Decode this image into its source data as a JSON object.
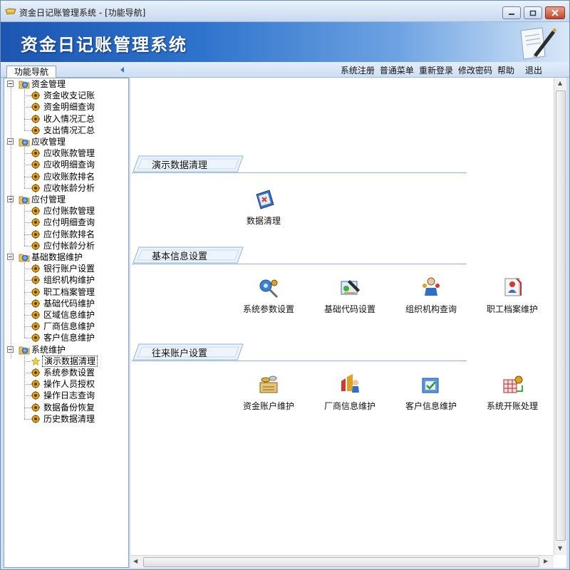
{
  "window": {
    "title": "资金日记账管理系统 - [功能导航]",
    "banner_title": "资金日记账管理系统"
  },
  "toolbar": {
    "nav_tab": "功能导航",
    "menu": [
      "系统注册",
      "普通菜单",
      "重新登录",
      "修改密码",
      "帮助",
      "退出"
    ]
  },
  "tree": {
    "groups": [
      {
        "label": "资金管理",
        "items": [
          "资金收支记账",
          "资金明细查询",
          "收入情况汇总",
          "支出情况汇总"
        ]
      },
      {
        "label": "应收管理",
        "items": [
          "应收账款管理",
          "应收明细查询",
          "应收账款排名",
          "应收帐龄分析"
        ]
      },
      {
        "label": "应付管理",
        "items": [
          "应付账款管理",
          "应付明细查询",
          "应付账款排名",
          "应付帐龄分析"
        ]
      },
      {
        "label": "基础数据维护",
        "items": [
          "银行账户设置",
          "组织机构维护",
          "职工档案管理",
          "基础代码维护",
          "区域信息维护",
          "厂商信息维护",
          "客户信息维护"
        ]
      },
      {
        "label": "系统维护",
        "items": [
          "演示数据清理",
          "系统参数设置",
          "操作人员授权",
          "操作日志查询",
          "数据备份恢复",
          "历史数据清理"
        ]
      }
    ],
    "selected": "演示数据清理"
  },
  "sections": [
    {
      "title": "演示数据清理",
      "tiles": [
        {
          "label": "数据清理",
          "icon": "data-clean-icon"
        }
      ]
    },
    {
      "title": "基本信息设置",
      "tiles": [
        {
          "label": "系统参数设置",
          "icon": "system-params-icon"
        },
        {
          "label": "基础代码设置",
          "icon": "base-code-icon"
        },
        {
          "label": "组织机构查询",
          "icon": "org-query-icon"
        },
        {
          "label": "职工档案维护",
          "icon": "staff-file-icon"
        }
      ]
    },
    {
      "title": "往来账户设置",
      "tiles": [
        {
          "label": "资金账户维护",
          "icon": "fund-account-icon"
        },
        {
          "label": "厂商信息维护",
          "icon": "vendor-info-icon"
        },
        {
          "label": "客户信息维护",
          "icon": "customer-info-icon"
        },
        {
          "label": "系统开账处理",
          "icon": "open-books-icon"
        }
      ]
    }
  ],
  "colors": {
    "banner_dark": "#1c56b1",
    "banner_light": "#d8e8f8",
    "section_line": "#8fb3dd",
    "tree_leaf_icon": "#e0a020"
  }
}
